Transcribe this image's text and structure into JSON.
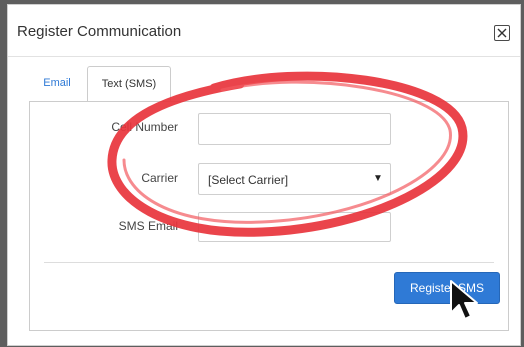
{
  "dialog": {
    "title": "Register Communication",
    "close_icon": "close-icon"
  },
  "tabs": [
    {
      "label": "Email",
      "active": false
    },
    {
      "label": "Text (SMS)",
      "active": true
    }
  ],
  "form": {
    "cell_number_label": "Cell Number",
    "cell_number_value": "",
    "carrier_label": "Carrier",
    "carrier_selected": "[Select Carrier]",
    "sms_email_label": "SMS Email",
    "sms_email_value": ""
  },
  "actions": {
    "register_label": "Register SMS"
  },
  "colors": {
    "accent": "#2f7ad6",
    "annotation": "#e8343c"
  },
  "icons": {
    "dropdown": "chevron-down-icon",
    "cursor": "mouse-pointer-icon"
  }
}
